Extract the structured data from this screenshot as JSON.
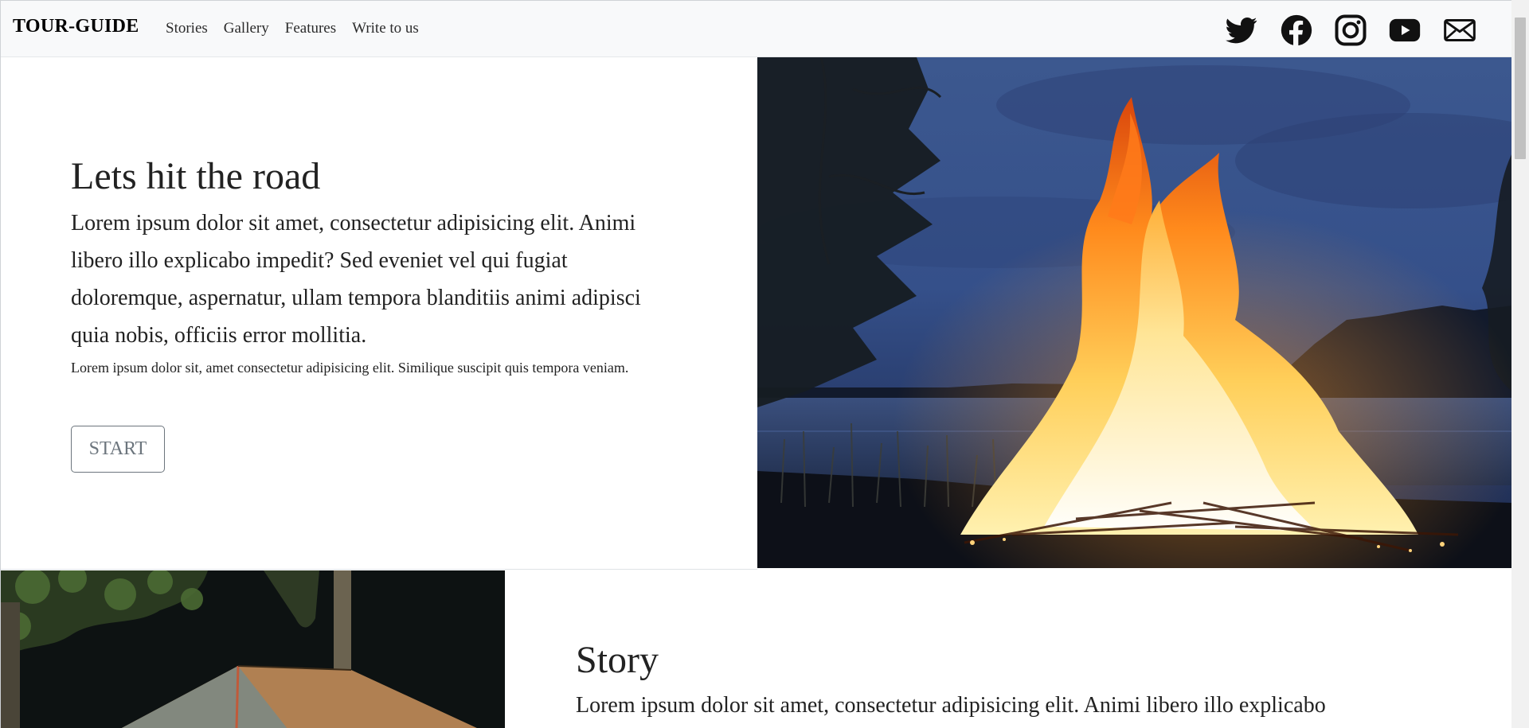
{
  "navbar": {
    "brand": "TOUR-GUIDE",
    "links": [
      "Stories",
      "Gallery",
      "Features",
      "Write to us"
    ],
    "social_icons": [
      "twitter-icon",
      "facebook-icon",
      "instagram-icon",
      "youtube-icon",
      "envelope-icon"
    ]
  },
  "hero": {
    "title": "Lets hit the road",
    "lead": "Lorem ipsum dolor sit amet, consectetur adipisicing elit. Animi libero illo explicabo impedit? Sed eveniet vel qui fugiat doloremque, aspernatur, ullam tempora blanditiis animi adipisci quia nobis, officiis error mollitia.",
    "small": "Lorem ipsum dolor sit, amet consectetur adipisicing elit. Similique suscipit quis tempora veniam.",
    "button_label": "START"
  },
  "story": {
    "title": "Story",
    "lead": "Lorem ipsum dolor sit amet, consectetur adipisicing elit. Animi libero illo explicabo"
  },
  "colors": {
    "navbar_bg": "#f8f9fa",
    "text": "#212529",
    "button_border": "#6c757d"
  }
}
